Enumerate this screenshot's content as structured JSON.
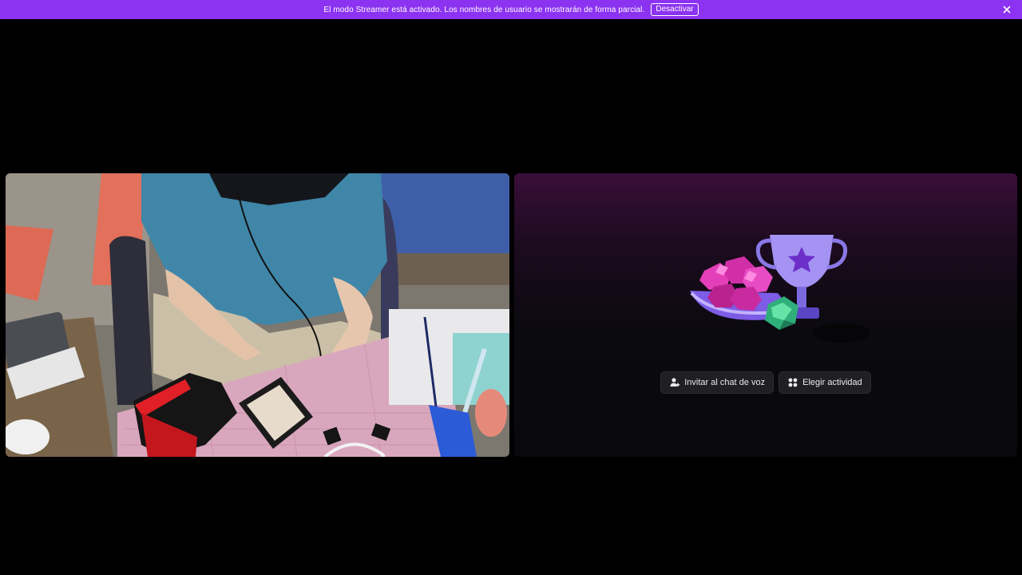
{
  "banner": {
    "message": "El modo Streamer está activado. Los nombres de usuario se mostrarán de forma parcial.",
    "disable_label": "Desactivar",
    "color": "#8c33f1"
  },
  "activity_panel": {
    "invite_label": "Invitar al chat de voz",
    "choose_activity_label": "Elegir actividad",
    "icons": {
      "invite": "add-person-icon",
      "activity": "activity-grid-icon"
    }
  },
  "video_tile": {
    "icon": "camera-feed"
  }
}
